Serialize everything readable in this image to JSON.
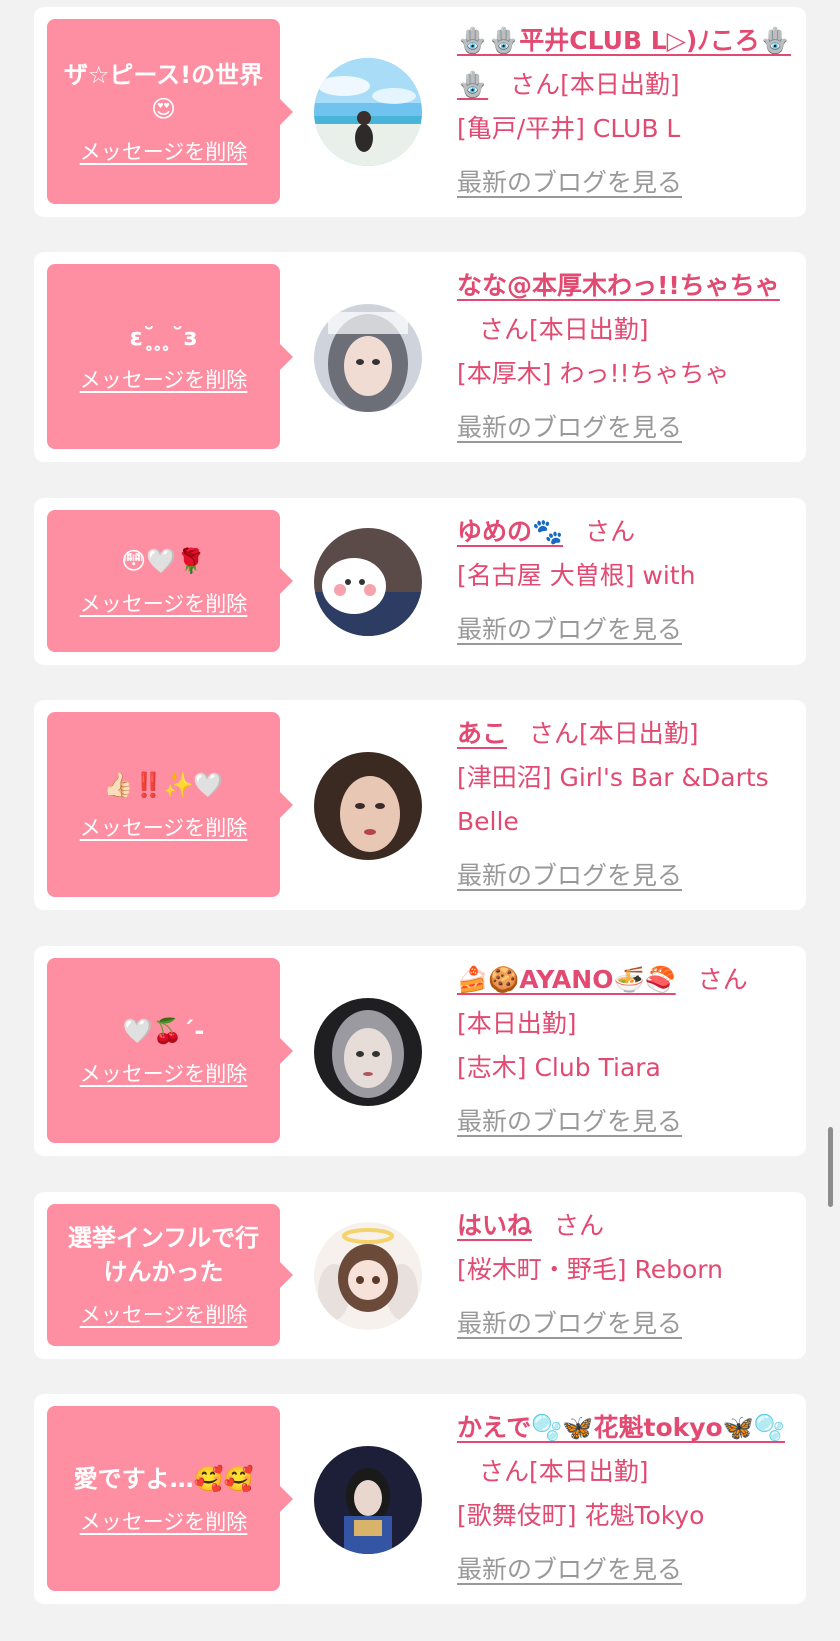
{
  "common": {
    "delete_label": "メッセージを削除",
    "san": "さん",
    "blog_label": "最新のブログを見る"
  },
  "cards": [
    {
      "message": "ザ☆ピース!の世界😍",
      "name": "🪬🪬平井CLUB L▷)ﾉころ🪬🪬",
      "status": "[本日出勤]",
      "shop": "[亀戸/平井] CLUB L",
      "avatar": "beach"
    },
    {
      "message": "ε˘̥ ̥ ̥˘з",
      "name": "なな@本厚木わっ!!ちゃちゃ",
      "status": "[本日出勤]",
      "shop": "[本厚木] わっ!!ちゃちゃ",
      "avatar": "girl-lace"
    },
    {
      "message": "😳🤍🌹",
      "name": "ゆめの🐾",
      "status": "",
      "shop": "[名古屋 大曽根] with",
      "avatar": "sticker"
    },
    {
      "message": "👍🏻‼️✨🤍",
      "name": "あこ",
      "status": "[本日出勤]",
      "shop": "[津田沼] Girl's Bar &Darts Belle",
      "avatar": "girl-close"
    },
    {
      "message": "🤍🍒´-",
      "name": "🍰🍪AYANO🍜🍣",
      "status": "[本日出勤]",
      "shop": "[志木] Club Tiara",
      "avatar": "girl-mono"
    },
    {
      "message": "選挙インフルで行けんかった",
      "name": "はいね",
      "status": "",
      "shop": "[桜木町・野毛] Reborn",
      "avatar": "angel"
    },
    {
      "message": "愛ですよ…🥰🥰",
      "name": "かえで🫧🦋花魁tokyo🦋🫧",
      "status": "[本日出勤]",
      "shop": "[歌舞伎町] 花魁Tokyo",
      "avatar": "kimono"
    }
  ]
}
